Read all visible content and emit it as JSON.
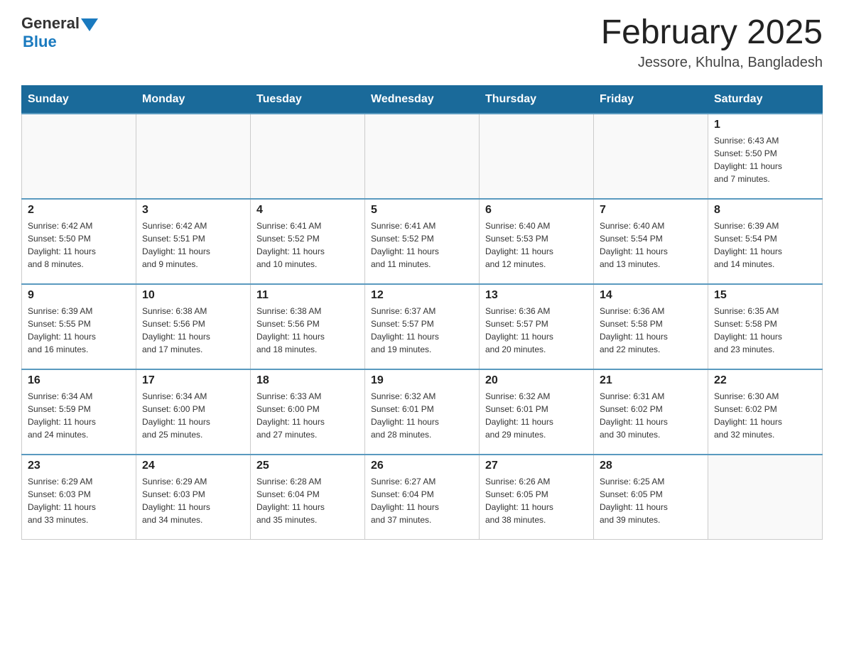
{
  "header": {
    "title": "February 2025",
    "subtitle": "Jessore, Khulna, Bangladesh"
  },
  "logo": {
    "general": "General",
    "blue": "Blue"
  },
  "weekdays": [
    "Sunday",
    "Monday",
    "Tuesday",
    "Wednesday",
    "Thursday",
    "Friday",
    "Saturday"
  ],
  "weeks": [
    [
      {
        "day": "",
        "info": ""
      },
      {
        "day": "",
        "info": ""
      },
      {
        "day": "",
        "info": ""
      },
      {
        "day": "",
        "info": ""
      },
      {
        "day": "",
        "info": ""
      },
      {
        "day": "",
        "info": ""
      },
      {
        "day": "1",
        "info": "Sunrise: 6:43 AM\nSunset: 5:50 PM\nDaylight: 11 hours\nand 7 minutes."
      }
    ],
    [
      {
        "day": "2",
        "info": "Sunrise: 6:42 AM\nSunset: 5:50 PM\nDaylight: 11 hours\nand 8 minutes."
      },
      {
        "day": "3",
        "info": "Sunrise: 6:42 AM\nSunset: 5:51 PM\nDaylight: 11 hours\nand 9 minutes."
      },
      {
        "day": "4",
        "info": "Sunrise: 6:41 AM\nSunset: 5:52 PM\nDaylight: 11 hours\nand 10 minutes."
      },
      {
        "day": "5",
        "info": "Sunrise: 6:41 AM\nSunset: 5:52 PM\nDaylight: 11 hours\nand 11 minutes."
      },
      {
        "day": "6",
        "info": "Sunrise: 6:40 AM\nSunset: 5:53 PM\nDaylight: 11 hours\nand 12 minutes."
      },
      {
        "day": "7",
        "info": "Sunrise: 6:40 AM\nSunset: 5:54 PM\nDaylight: 11 hours\nand 13 minutes."
      },
      {
        "day": "8",
        "info": "Sunrise: 6:39 AM\nSunset: 5:54 PM\nDaylight: 11 hours\nand 14 minutes."
      }
    ],
    [
      {
        "day": "9",
        "info": "Sunrise: 6:39 AM\nSunset: 5:55 PM\nDaylight: 11 hours\nand 16 minutes."
      },
      {
        "day": "10",
        "info": "Sunrise: 6:38 AM\nSunset: 5:56 PM\nDaylight: 11 hours\nand 17 minutes."
      },
      {
        "day": "11",
        "info": "Sunrise: 6:38 AM\nSunset: 5:56 PM\nDaylight: 11 hours\nand 18 minutes."
      },
      {
        "day": "12",
        "info": "Sunrise: 6:37 AM\nSunset: 5:57 PM\nDaylight: 11 hours\nand 19 minutes."
      },
      {
        "day": "13",
        "info": "Sunrise: 6:36 AM\nSunset: 5:57 PM\nDaylight: 11 hours\nand 20 minutes."
      },
      {
        "day": "14",
        "info": "Sunrise: 6:36 AM\nSunset: 5:58 PM\nDaylight: 11 hours\nand 22 minutes."
      },
      {
        "day": "15",
        "info": "Sunrise: 6:35 AM\nSunset: 5:58 PM\nDaylight: 11 hours\nand 23 minutes."
      }
    ],
    [
      {
        "day": "16",
        "info": "Sunrise: 6:34 AM\nSunset: 5:59 PM\nDaylight: 11 hours\nand 24 minutes."
      },
      {
        "day": "17",
        "info": "Sunrise: 6:34 AM\nSunset: 6:00 PM\nDaylight: 11 hours\nand 25 minutes."
      },
      {
        "day": "18",
        "info": "Sunrise: 6:33 AM\nSunset: 6:00 PM\nDaylight: 11 hours\nand 27 minutes."
      },
      {
        "day": "19",
        "info": "Sunrise: 6:32 AM\nSunset: 6:01 PM\nDaylight: 11 hours\nand 28 minutes."
      },
      {
        "day": "20",
        "info": "Sunrise: 6:32 AM\nSunset: 6:01 PM\nDaylight: 11 hours\nand 29 minutes."
      },
      {
        "day": "21",
        "info": "Sunrise: 6:31 AM\nSunset: 6:02 PM\nDaylight: 11 hours\nand 30 minutes."
      },
      {
        "day": "22",
        "info": "Sunrise: 6:30 AM\nSunset: 6:02 PM\nDaylight: 11 hours\nand 32 minutes."
      }
    ],
    [
      {
        "day": "23",
        "info": "Sunrise: 6:29 AM\nSunset: 6:03 PM\nDaylight: 11 hours\nand 33 minutes."
      },
      {
        "day": "24",
        "info": "Sunrise: 6:29 AM\nSunset: 6:03 PM\nDaylight: 11 hours\nand 34 minutes."
      },
      {
        "day": "25",
        "info": "Sunrise: 6:28 AM\nSunset: 6:04 PM\nDaylight: 11 hours\nand 35 minutes."
      },
      {
        "day": "26",
        "info": "Sunrise: 6:27 AM\nSunset: 6:04 PM\nDaylight: 11 hours\nand 37 minutes."
      },
      {
        "day": "27",
        "info": "Sunrise: 6:26 AM\nSunset: 6:05 PM\nDaylight: 11 hours\nand 38 minutes."
      },
      {
        "day": "28",
        "info": "Sunrise: 6:25 AM\nSunset: 6:05 PM\nDaylight: 11 hours\nand 39 minutes."
      },
      {
        "day": "",
        "info": ""
      }
    ]
  ]
}
